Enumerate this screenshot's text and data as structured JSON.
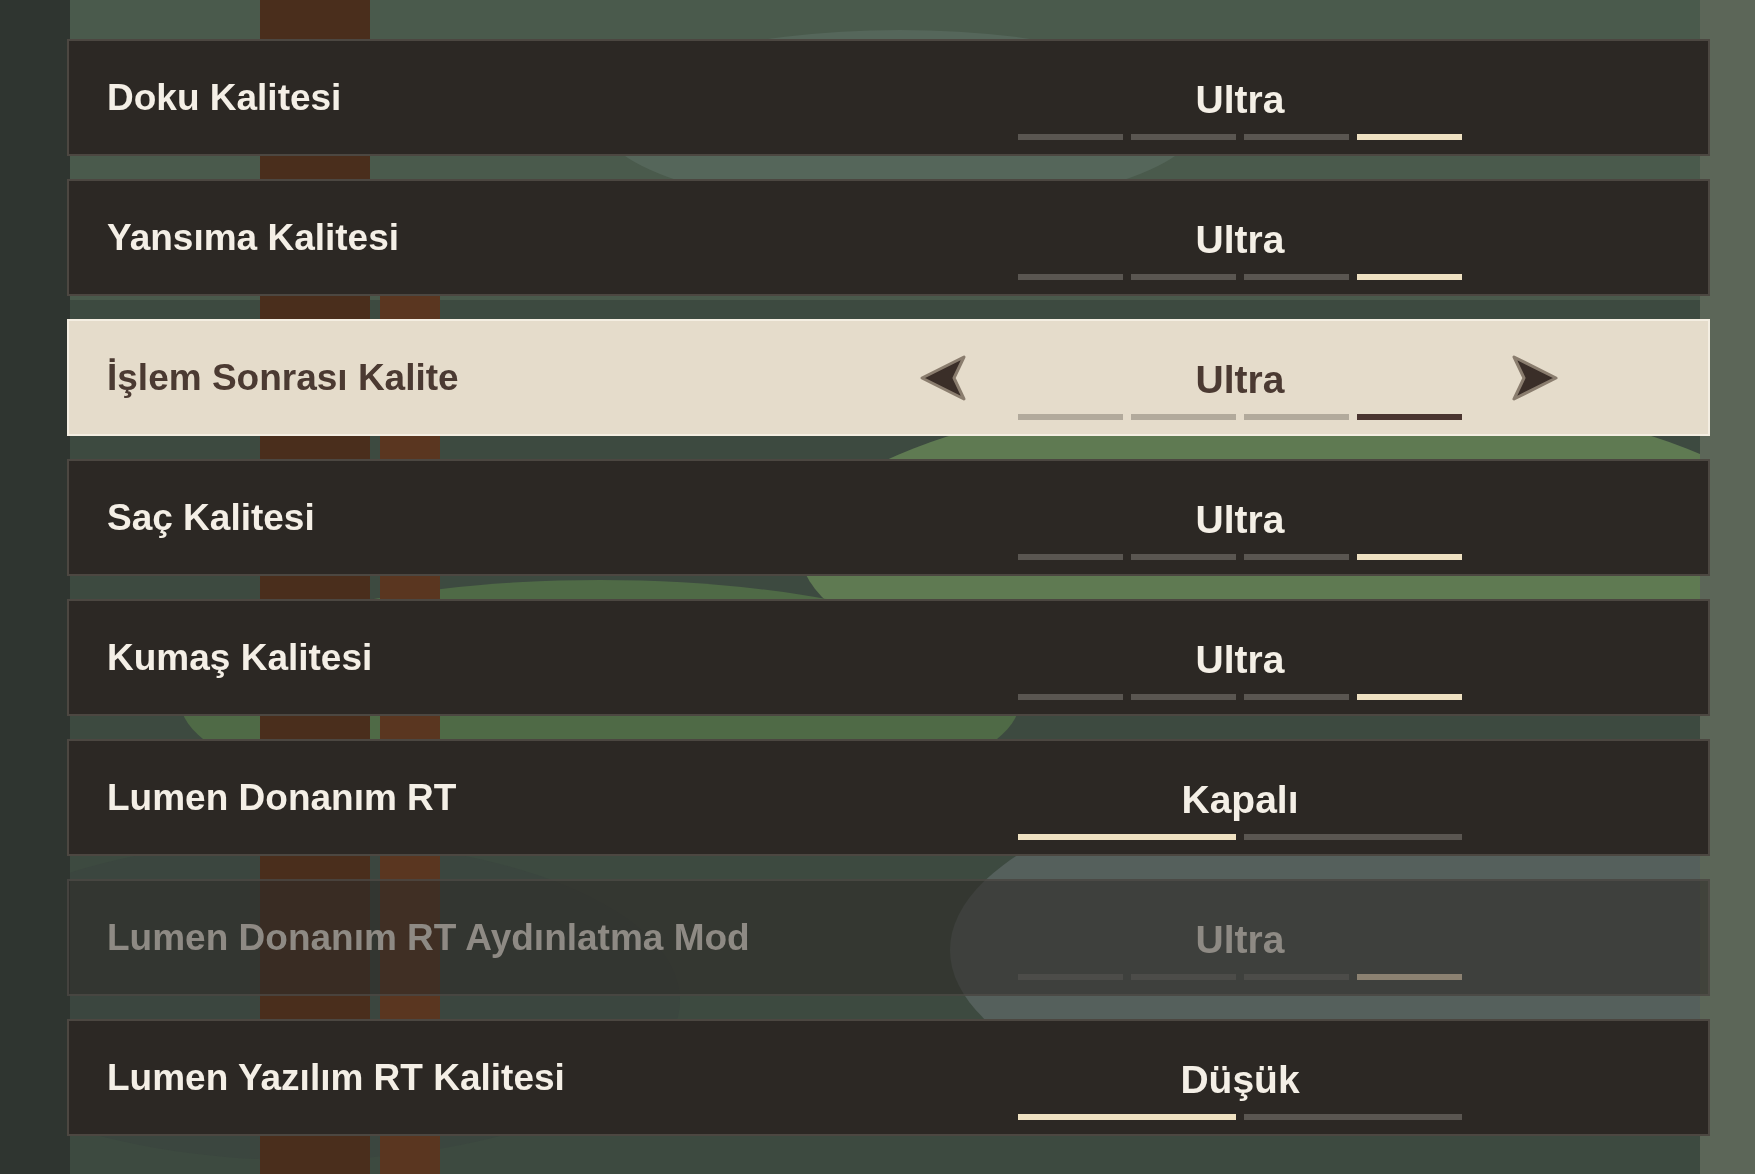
{
  "rows": [
    {
      "label": "Doku Kalitesi",
      "value": "Ultra",
      "selected": false,
      "disabled": false,
      "segments": [
        {
          "lit": false
        },
        {
          "lit": false
        },
        {
          "lit": false
        },
        {
          "lit": true
        }
      ]
    },
    {
      "label": "Yansıma Kalitesi",
      "value": "Ultra",
      "selected": false,
      "disabled": false,
      "segments": [
        {
          "lit": false
        },
        {
          "lit": false
        },
        {
          "lit": false
        },
        {
          "lit": true
        }
      ]
    },
    {
      "label": "İşlem Sonrası Kalite",
      "value": "Ultra",
      "selected": true,
      "disabled": false,
      "segments": [
        {
          "lit": false
        },
        {
          "lit": false
        },
        {
          "lit": false
        },
        {
          "lit": true
        }
      ]
    },
    {
      "label": "Saç Kalitesi",
      "value": "Ultra",
      "selected": false,
      "disabled": false,
      "segments": [
        {
          "lit": false
        },
        {
          "lit": false
        },
        {
          "lit": false
        },
        {
          "lit": true
        }
      ]
    },
    {
      "label": "Kumaş Kalitesi",
      "value": "Ultra",
      "selected": false,
      "disabled": false,
      "segments": [
        {
          "lit": false
        },
        {
          "lit": false
        },
        {
          "lit": false
        },
        {
          "lit": true
        }
      ]
    },
    {
      "label": "Lumen Donanım RT",
      "value": "Kapalı",
      "selected": false,
      "disabled": false,
      "segments": [
        {
          "lit": true
        },
        {
          "lit": false
        }
      ]
    },
    {
      "label": "Lumen Donanım RT Aydınlatma Mod",
      "value": "Ultra",
      "selected": false,
      "disabled": true,
      "segments": [
        {
          "lit": false
        },
        {
          "lit": false
        },
        {
          "lit": false
        },
        {
          "lit": true
        }
      ]
    },
    {
      "label": "Lumen Yazılım RT Kalitesi",
      "value": "Düşük",
      "selected": false,
      "disabled": false,
      "segments": [
        {
          "lit": true
        },
        {
          "lit": false
        }
      ]
    }
  ]
}
